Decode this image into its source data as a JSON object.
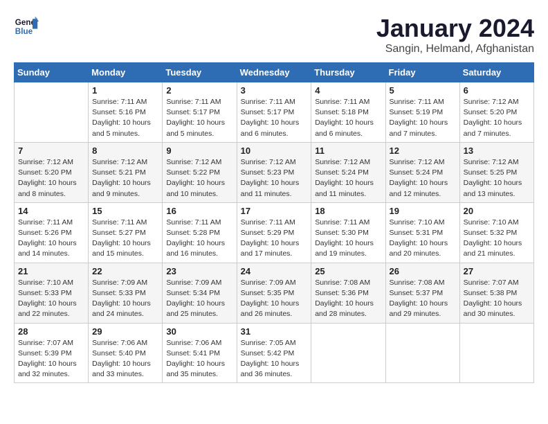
{
  "header": {
    "logo_line1": "General",
    "logo_line2": "Blue",
    "title": "January 2024",
    "subtitle": "Sangin, Helmand, Afghanistan"
  },
  "calendar": {
    "days_of_week": [
      "Sunday",
      "Monday",
      "Tuesday",
      "Wednesday",
      "Thursday",
      "Friday",
      "Saturday"
    ],
    "weeks": [
      [
        {
          "day": "",
          "info": ""
        },
        {
          "day": "1",
          "info": "Sunrise: 7:11 AM\nSunset: 5:16 PM\nDaylight: 10 hours\nand 5 minutes."
        },
        {
          "day": "2",
          "info": "Sunrise: 7:11 AM\nSunset: 5:17 PM\nDaylight: 10 hours\nand 5 minutes."
        },
        {
          "day": "3",
          "info": "Sunrise: 7:11 AM\nSunset: 5:17 PM\nDaylight: 10 hours\nand 6 minutes."
        },
        {
          "day": "4",
          "info": "Sunrise: 7:11 AM\nSunset: 5:18 PM\nDaylight: 10 hours\nand 6 minutes."
        },
        {
          "day": "5",
          "info": "Sunrise: 7:11 AM\nSunset: 5:19 PM\nDaylight: 10 hours\nand 7 minutes."
        },
        {
          "day": "6",
          "info": "Sunrise: 7:12 AM\nSunset: 5:20 PM\nDaylight: 10 hours\nand 7 minutes."
        }
      ],
      [
        {
          "day": "7",
          "info": "Sunrise: 7:12 AM\nSunset: 5:20 PM\nDaylight: 10 hours\nand 8 minutes."
        },
        {
          "day": "8",
          "info": "Sunrise: 7:12 AM\nSunset: 5:21 PM\nDaylight: 10 hours\nand 9 minutes."
        },
        {
          "day": "9",
          "info": "Sunrise: 7:12 AM\nSunset: 5:22 PM\nDaylight: 10 hours\nand 10 minutes."
        },
        {
          "day": "10",
          "info": "Sunrise: 7:12 AM\nSunset: 5:23 PM\nDaylight: 10 hours\nand 11 minutes."
        },
        {
          "day": "11",
          "info": "Sunrise: 7:12 AM\nSunset: 5:24 PM\nDaylight: 10 hours\nand 11 minutes."
        },
        {
          "day": "12",
          "info": "Sunrise: 7:12 AM\nSunset: 5:24 PM\nDaylight: 10 hours\nand 12 minutes."
        },
        {
          "day": "13",
          "info": "Sunrise: 7:12 AM\nSunset: 5:25 PM\nDaylight: 10 hours\nand 13 minutes."
        }
      ],
      [
        {
          "day": "14",
          "info": "Sunrise: 7:11 AM\nSunset: 5:26 PM\nDaylight: 10 hours\nand 14 minutes."
        },
        {
          "day": "15",
          "info": "Sunrise: 7:11 AM\nSunset: 5:27 PM\nDaylight: 10 hours\nand 15 minutes."
        },
        {
          "day": "16",
          "info": "Sunrise: 7:11 AM\nSunset: 5:28 PM\nDaylight: 10 hours\nand 16 minutes."
        },
        {
          "day": "17",
          "info": "Sunrise: 7:11 AM\nSunset: 5:29 PM\nDaylight: 10 hours\nand 17 minutes."
        },
        {
          "day": "18",
          "info": "Sunrise: 7:11 AM\nSunset: 5:30 PM\nDaylight: 10 hours\nand 19 minutes."
        },
        {
          "day": "19",
          "info": "Sunrise: 7:10 AM\nSunset: 5:31 PM\nDaylight: 10 hours\nand 20 minutes."
        },
        {
          "day": "20",
          "info": "Sunrise: 7:10 AM\nSunset: 5:32 PM\nDaylight: 10 hours\nand 21 minutes."
        }
      ],
      [
        {
          "day": "21",
          "info": "Sunrise: 7:10 AM\nSunset: 5:33 PM\nDaylight: 10 hours\nand 22 minutes."
        },
        {
          "day": "22",
          "info": "Sunrise: 7:09 AM\nSunset: 5:33 PM\nDaylight: 10 hours\nand 24 minutes."
        },
        {
          "day": "23",
          "info": "Sunrise: 7:09 AM\nSunset: 5:34 PM\nDaylight: 10 hours\nand 25 minutes."
        },
        {
          "day": "24",
          "info": "Sunrise: 7:09 AM\nSunset: 5:35 PM\nDaylight: 10 hours\nand 26 minutes."
        },
        {
          "day": "25",
          "info": "Sunrise: 7:08 AM\nSunset: 5:36 PM\nDaylight: 10 hours\nand 28 minutes."
        },
        {
          "day": "26",
          "info": "Sunrise: 7:08 AM\nSunset: 5:37 PM\nDaylight: 10 hours\nand 29 minutes."
        },
        {
          "day": "27",
          "info": "Sunrise: 7:07 AM\nSunset: 5:38 PM\nDaylight: 10 hours\nand 30 minutes."
        }
      ],
      [
        {
          "day": "28",
          "info": "Sunrise: 7:07 AM\nSunset: 5:39 PM\nDaylight: 10 hours\nand 32 minutes."
        },
        {
          "day": "29",
          "info": "Sunrise: 7:06 AM\nSunset: 5:40 PM\nDaylight: 10 hours\nand 33 minutes."
        },
        {
          "day": "30",
          "info": "Sunrise: 7:06 AM\nSunset: 5:41 PM\nDaylight: 10 hours\nand 35 minutes."
        },
        {
          "day": "31",
          "info": "Sunrise: 7:05 AM\nSunset: 5:42 PM\nDaylight: 10 hours\nand 36 minutes."
        },
        {
          "day": "",
          "info": ""
        },
        {
          "day": "",
          "info": ""
        },
        {
          "day": "",
          "info": ""
        }
      ]
    ]
  }
}
